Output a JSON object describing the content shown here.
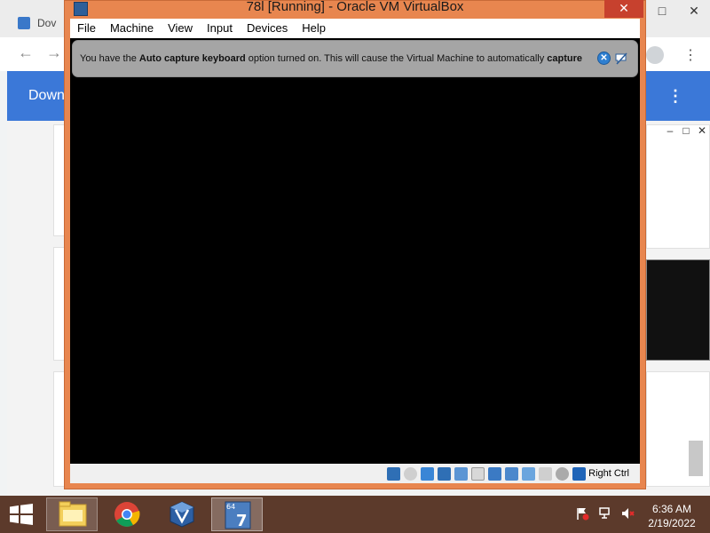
{
  "background_browser": {
    "tab_title": "Dov",
    "window_controls": [
      "–",
      "□",
      "✕"
    ],
    "banner_text": "Down",
    "side_controls": [
      "–",
      "□",
      "✕"
    ]
  },
  "vbox": {
    "title": "78l [Running] - Oracle VM VirtualBox",
    "menu": [
      "File",
      "Machine",
      "View",
      "Input",
      "Devices",
      "Help"
    ],
    "notice": {
      "pre": "You have the ",
      "bold1": "Auto capture keyboard",
      "mid": " option turned on. This will cause the Virtual Machine to automatically ",
      "bold2": "capture"
    },
    "host_key": "Right Ctrl",
    "colors": {
      "title_bar": "#e8864f",
      "screen": "#000000",
      "notice": "#a5a5a5"
    }
  },
  "taskbar": {
    "items": [
      "file-explorer",
      "chrome",
      "virtualbox-manager",
      "virtual-machine-window"
    ],
    "time": "6:36 AM",
    "date": "2/19/2022",
    "color": "#5c3a2b"
  }
}
